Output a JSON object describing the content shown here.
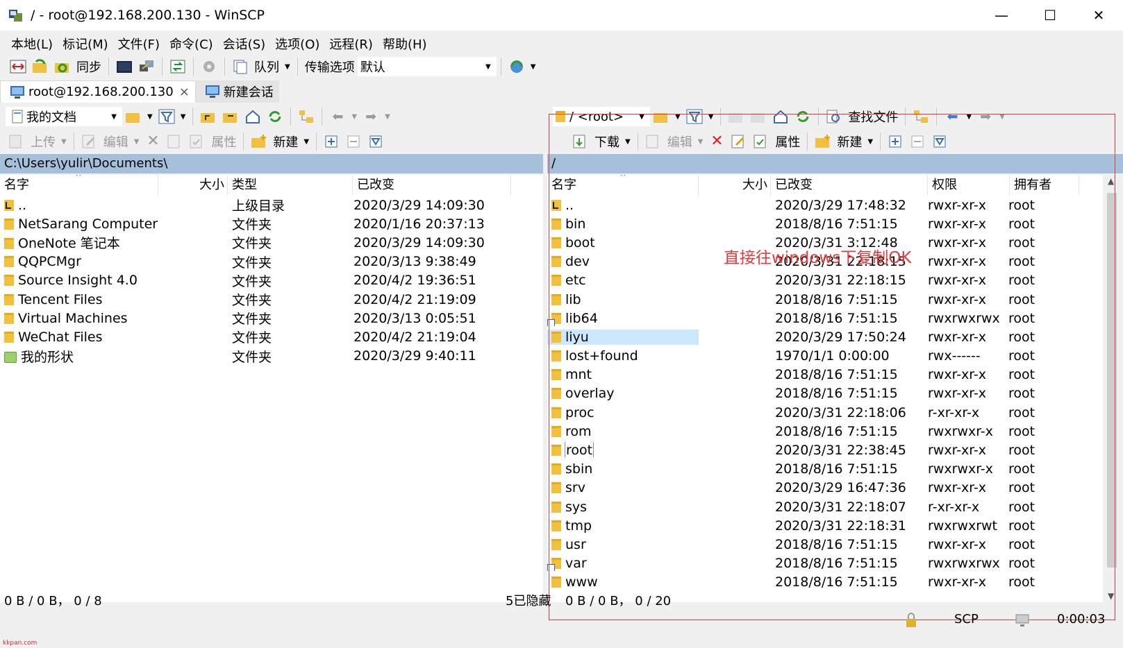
{
  "window": {
    "title": "/ - root@192.168.200.130 - WinSCP",
    "minimize": "—",
    "maximize": "☐",
    "close": "✕"
  },
  "menu": [
    "本地(L)",
    "标记(M)",
    "文件(F)",
    "命令(C)",
    "会话(S)",
    "选项(O)",
    "远程(R)",
    "帮助(H)"
  ],
  "toolbar": {
    "sync": "同步",
    "queue": "队列",
    "transfer_options": "传输选项",
    "transfer_default": "默认"
  },
  "tabs": {
    "session": "root@192.168.200.130",
    "close": "×",
    "new_session": "新建会话"
  },
  "left": {
    "location": "我的文档",
    "actions": {
      "upload": "上传",
      "edit": "编辑",
      "properties": "属性",
      "new": "新建"
    },
    "path": "C:\\Users\\yulir\\Documents\\",
    "columns": [
      "名字",
      "大小",
      "类型",
      "已改变"
    ],
    "rows": [
      {
        "name": "..",
        "size": "",
        "type": "上级目录",
        "changed": "2020/3/29  14:09:30",
        "icon": "updir"
      },
      {
        "name": "NetSarang Computer",
        "size": "",
        "type": "文件夹",
        "changed": "2020/1/16  20:37:13",
        "icon": "folder"
      },
      {
        "name": "OneNote 笔记本",
        "size": "",
        "type": "文件夹",
        "changed": "2020/3/29  14:09:30",
        "icon": "folder"
      },
      {
        "name": "QQPCMgr",
        "size": "",
        "type": "文件夹",
        "changed": "2020/3/13  9:38:49",
        "icon": "folder"
      },
      {
        "name": "Source Insight 4.0",
        "size": "",
        "type": "文件夹",
        "changed": "2020/4/2  19:36:51",
        "icon": "folder"
      },
      {
        "name": "Tencent Files",
        "size": "",
        "type": "文件夹",
        "changed": "2020/4/2  21:19:09",
        "icon": "folder"
      },
      {
        "name": "Virtual Machines",
        "size": "",
        "type": "文件夹",
        "changed": "2020/3/13  0:05:51",
        "icon": "folder"
      },
      {
        "name": "WeChat Files",
        "size": "",
        "type": "文件夹",
        "changed": "2020/4/2  21:19:04",
        "icon": "folder"
      },
      {
        "name": "我的形状",
        "size": "",
        "type": "文件夹",
        "changed": "2020/3/29  9:40:11",
        "icon": "shape"
      }
    ],
    "status": "0 B / 0 B，  0 / 8"
  },
  "right": {
    "location": "/ <root>",
    "find_files": "查找文件",
    "actions": {
      "download": "下载",
      "edit": "编辑",
      "properties": "属性",
      "new": "新建"
    },
    "path": "/",
    "columns": [
      "名字",
      "大小",
      "已改变",
      "权限",
      "拥有者"
    ],
    "rows": [
      {
        "name": "..",
        "size": "",
        "changed": "2020/3/29 17:48:32",
        "rights": "rwxr-xr-x",
        "owner": "root",
        "icon": "updir"
      },
      {
        "name": "bin",
        "size": "",
        "changed": "2018/8/16 7:51:15",
        "rights": "rwxr-xr-x",
        "owner": "root",
        "icon": "folder"
      },
      {
        "name": "boot",
        "size": "",
        "changed": "2020/3/31 3:12:48",
        "rights": "rwxr-xr-x",
        "owner": "root",
        "icon": "folder"
      },
      {
        "name": "dev",
        "size": "",
        "changed": "2020/3/31 22:18:15",
        "rights": "rwxr-xr-x",
        "owner": "root",
        "icon": "folder"
      },
      {
        "name": "etc",
        "size": "",
        "changed": "2020/3/31 22:18:15",
        "rights": "rwxr-xr-x",
        "owner": "root",
        "icon": "folder"
      },
      {
        "name": "lib",
        "size": "",
        "changed": "2018/8/16 7:51:15",
        "rights": "rwxr-xr-x",
        "owner": "root",
        "icon": "folder"
      },
      {
        "name": "lib64",
        "size": "",
        "changed": "2018/8/16 7:51:15",
        "rights": "rwxrwxrwx",
        "owner": "root",
        "icon": "link"
      },
      {
        "name": "liyu",
        "size": "",
        "changed": "2020/3/29 17:50:24",
        "rights": "rwxr-xr-x",
        "owner": "root",
        "icon": "folder",
        "selected": true
      },
      {
        "name": "lost+found",
        "size": "",
        "changed": "1970/1/1 0:00:00",
        "rights": "rwx------",
        "owner": "root",
        "icon": "folder"
      },
      {
        "name": "mnt",
        "size": "",
        "changed": "2018/8/16 7:51:15",
        "rights": "rwxr-xr-x",
        "owner": "root",
        "icon": "folder"
      },
      {
        "name": "overlay",
        "size": "",
        "changed": "2018/8/16 7:51:15",
        "rights": "rwxr-xr-x",
        "owner": "root",
        "icon": "folder"
      },
      {
        "name": "proc",
        "size": "",
        "changed": "2020/3/31 22:18:06",
        "rights": "r-xr-xr-x",
        "owner": "root",
        "icon": "folder"
      },
      {
        "name": "rom",
        "size": "",
        "changed": "2018/8/16 7:51:15",
        "rights": "rwxrwxr-x",
        "owner": "root",
        "icon": "folder"
      },
      {
        "name": "root",
        "size": "",
        "changed": "2020/3/31 22:38:45",
        "rights": "rwxr-xr-x",
        "owner": "root",
        "icon": "folder",
        "focused": true
      },
      {
        "name": "sbin",
        "size": "",
        "changed": "2018/8/16 7:51:15",
        "rights": "rwxrwxr-x",
        "owner": "root",
        "icon": "folder"
      },
      {
        "name": "srv",
        "size": "",
        "changed": "2020/3/29 16:47:36",
        "rights": "rwxr-xr-x",
        "owner": "root",
        "icon": "folder"
      },
      {
        "name": "sys",
        "size": "",
        "changed": "2020/3/31 22:18:07",
        "rights": "r-xr-xr-x",
        "owner": "root",
        "icon": "folder"
      },
      {
        "name": "tmp",
        "size": "",
        "changed": "2020/3/31 22:18:31",
        "rights": "rwxrwxrwt",
        "owner": "root",
        "icon": "folder"
      },
      {
        "name": "usr",
        "size": "",
        "changed": "2018/8/16 7:51:15",
        "rights": "rwxr-xr-x",
        "owner": "root",
        "icon": "folder"
      },
      {
        "name": "var",
        "size": "",
        "changed": "2018/8/16 7:51:15",
        "rights": "rwxrwxrwx",
        "owner": "root",
        "icon": "link"
      },
      {
        "name": "www",
        "size": "",
        "changed": "2018/8/16 7:51:15",
        "rights": "rwxr-xr-x",
        "owner": "root",
        "icon": "folder"
      }
    ],
    "hidden": "5已隐藏",
    "status": "0 B / 0 B，  0 / 20"
  },
  "annotation": "直接往windows下复制OK",
  "bottom": {
    "protocol": "SCP",
    "time": "0:00:03",
    "watermark": "kkpan.com"
  },
  "colors": {
    "path_bar": "#a6c0dc",
    "selection": "#cce8ff",
    "annotation": "#e03b3b"
  }
}
